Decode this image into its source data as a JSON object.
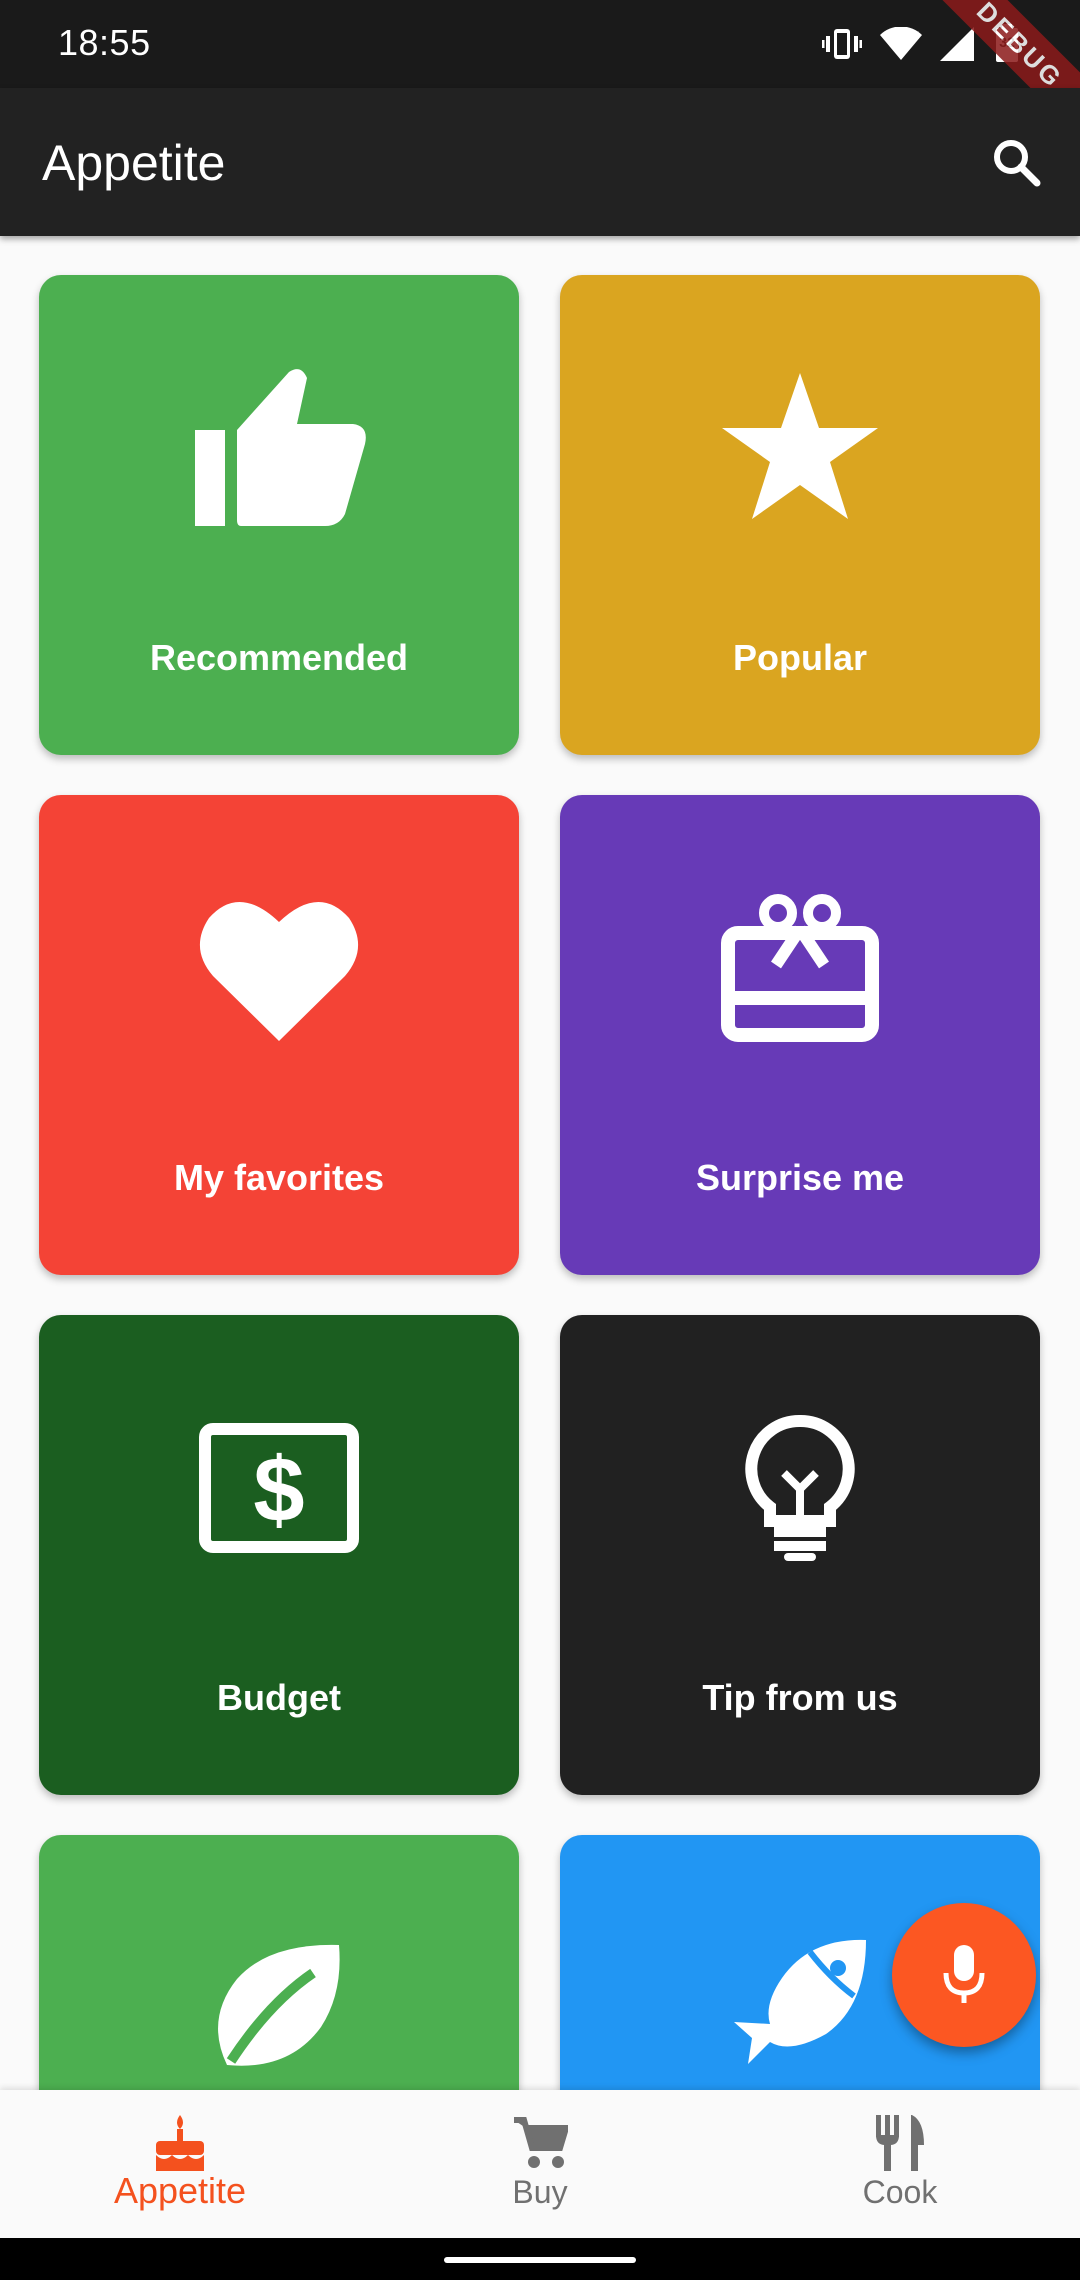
{
  "status_bar": {
    "time": "18:55",
    "battery_level": "32",
    "icons": [
      "vibrate-icon",
      "wifi-icon",
      "signal-icon",
      "battery-icon"
    ],
    "debug_banner": "DEBUG"
  },
  "app_bar": {
    "title": "Appetite",
    "search_icon": "search-icon"
  },
  "categories": [
    {
      "label": "Recommended",
      "icon": "thumbs-up-icon",
      "color": "#4caf50"
    },
    {
      "label": "Popular",
      "icon": "star-icon",
      "color": "#daa520"
    },
    {
      "label": "My favorites",
      "icon": "heart-icon",
      "color": "#f44336"
    },
    {
      "label": "Surprise me",
      "icon": "gift-card-icon",
      "color": "#673ab7"
    },
    {
      "label": "Budget",
      "icon": "money-bill-icon",
      "color": "#1b5e20"
    },
    {
      "label": "Tip from us",
      "icon": "lightbulb-icon",
      "color": "#212121"
    },
    {
      "label": "",
      "icon": "leaf-icon",
      "color": "#4caf50"
    },
    {
      "label": "",
      "icon": "fish-icon",
      "color": "#2196f3"
    }
  ],
  "fab": {
    "icon": "microphone-icon",
    "color": "#fc5722"
  },
  "bottom_nav": {
    "items": [
      {
        "label": "Appetite",
        "icon": "cake-icon",
        "active": true
      },
      {
        "label": "Buy",
        "icon": "cart-icon",
        "active": false
      },
      {
        "label": "Cook",
        "icon": "utensils-icon",
        "active": false
      }
    ],
    "active_color": "#f4511e",
    "inactive_color": "#707070"
  }
}
